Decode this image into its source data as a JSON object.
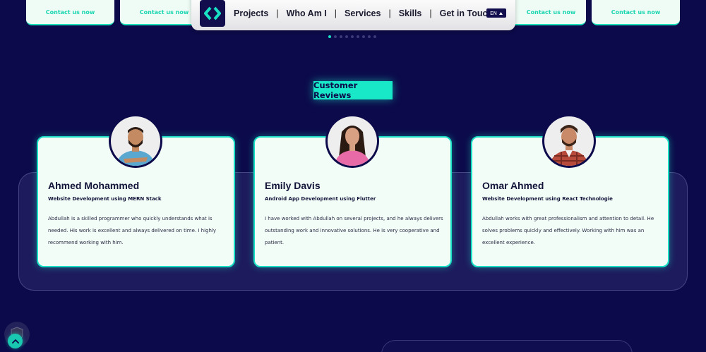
{
  "carousel": {
    "cards": [
      {
        "link": "Contact us now"
      },
      {
        "link": "Contact us now"
      },
      {
        "link": "Contact us now"
      },
      {
        "link": "Contact us now"
      }
    ],
    "dot_count": 9,
    "active_dot": 0
  },
  "nav": {
    "items": [
      "Projects",
      "Who Am I",
      "Services",
      "Skills",
      "Get in Touch"
    ],
    "lang": "EN"
  },
  "section": {
    "title": "Customer Reviews"
  },
  "reviews": [
    {
      "name": "Ahmed Mohammed",
      "role": "Website Development using MERN Stack",
      "text": "Abdullah is a skilled programmer who quickly understands what is needed. His work is excellent and always delivered on time. I highly recommend working with him."
    },
    {
      "name": "Emily Davis",
      "role": "Android App Development using Flutter",
      "text": "I have worked with Abdullah on several projects, and he always delivers outstanding work and innovative solutions. He is very cooperative and patient."
    },
    {
      "name": "Omar Ahmed",
      "role": "Website Development using React Technologie",
      "text": "Abdullah works with great professionalism and attention to detail. He solves problems quickly and effectively. Working with him was an excellent experience."
    }
  ],
  "colors": {
    "background": "#0c0a4a",
    "accent": "#19e0c4",
    "card": "#f2fdf7"
  },
  "icons": {
    "logo": "code-brackets-icon",
    "scroll_top": "chevron-up-icon",
    "shield": "shield-icon"
  }
}
